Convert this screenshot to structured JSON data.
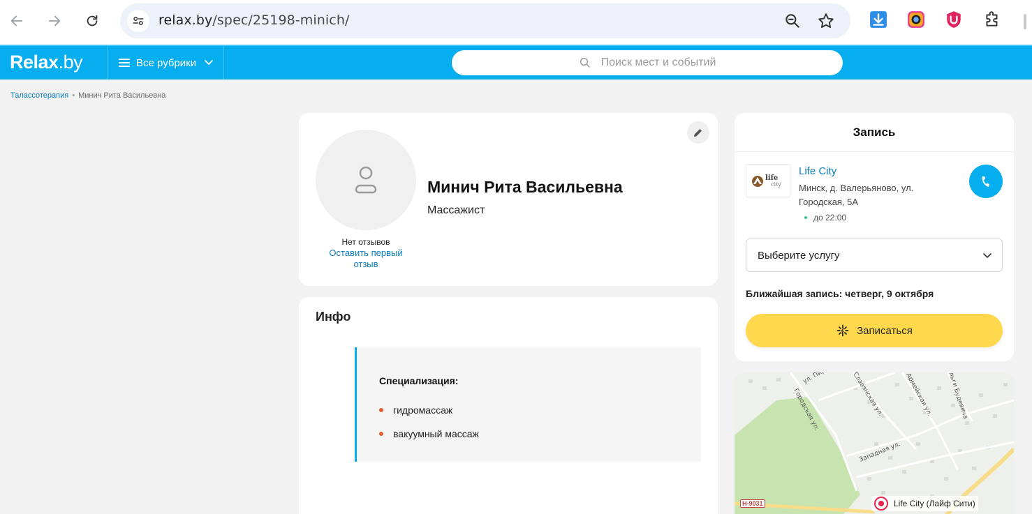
{
  "browser": {
    "url_host": "relax.by",
    "url_path": "/spec/25198-minich/"
  },
  "header": {
    "logo": "Relax",
    "logo_suffix": ".by",
    "rubrics_label": "Все рубрики",
    "search_placeholder": "Поиск мест и событий"
  },
  "breadcrumb": {
    "items": [
      "Талассотерапия",
      "Минич Рита Васильевна"
    ],
    "separator": "•"
  },
  "profile": {
    "name": "Минич Рита Васильевна",
    "role": "Массажист",
    "reviews_status": "Нет отзывов",
    "leave_review": "Оставить первый отзыв"
  },
  "info": {
    "title": "Инфо",
    "specialization_title": "Специализация:",
    "specializations": [
      "гидромассаж",
      "вакуумный массаж"
    ]
  },
  "booking": {
    "title": "Запись",
    "place_name": "Life City",
    "place_address": "Минск, д. Валерьяново, ул. Городская, 5А",
    "hours": "до 22:00",
    "service_select": "Выберите услугу",
    "nearest": "Ближайшая запись: четверг, 9 октября",
    "book_button": "Записаться"
  },
  "map": {
    "place_label": "Life City (Лайф Сити)",
    "road_sign": "Н-9031",
    "streets": [
      "ул. Пирогова",
      "Городская ул.",
      "Славянская ул.",
      "Армейская ул.",
      "Западная ул.",
      "Ольги Будевича"
    ]
  },
  "colors": {
    "brand": "#06aef0",
    "accent_yellow": "#ffd84d",
    "link": "#0a7dbd",
    "bullet": "#e95b2b",
    "map_pin": "#e8234b"
  }
}
